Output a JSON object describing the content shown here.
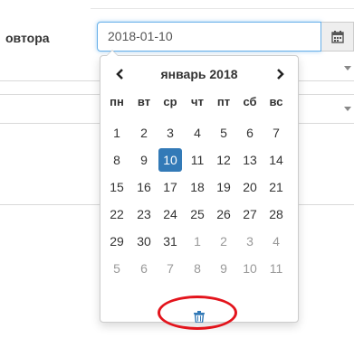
{
  "form": {
    "row_label": "овтора",
    "date_value": "2018-01-10"
  },
  "datepicker": {
    "month_title": "январь 2018",
    "weekdays": [
      "пн",
      "вт",
      "ср",
      "чт",
      "пт",
      "сб",
      "вс"
    ],
    "weeks": [
      [
        "1",
        "2",
        "3",
        "4",
        "5",
        "6",
        "7"
      ],
      [
        "8",
        "9",
        "10",
        "11",
        "12",
        "13",
        "14"
      ],
      [
        "15",
        "16",
        "17",
        "18",
        "19",
        "20",
        "21"
      ],
      [
        "22",
        "23",
        "24",
        "25",
        "26",
        "27",
        "28"
      ],
      [
        "29",
        "30",
        "31",
        "1",
        "2",
        "3",
        "4"
      ],
      [
        "5",
        "6",
        "7",
        "8",
        "9",
        "10",
        "11"
      ]
    ],
    "selected_day": "10",
    "accent_color": "#337ab7"
  },
  "annotation_color": "#e3141c",
  "icons": {
    "calendar": "calendar-icon",
    "prev": "chevron-left-icon",
    "next": "chevron-right-icon",
    "clear": "trash-icon"
  }
}
